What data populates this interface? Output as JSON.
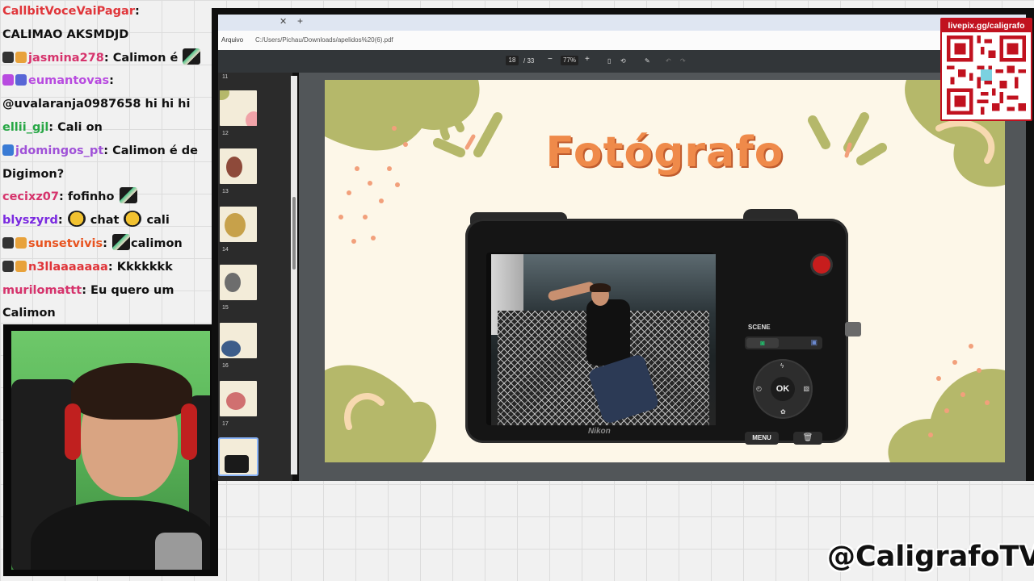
{
  "chat": {
    "lines": [
      {
        "user": "CallbitVoceVaiPagar",
        "color": "#e0353a",
        "message": ""
      },
      {
        "user": "",
        "color": "#111111",
        "message": "CALIMAO AKSMDJD"
      },
      {
        "user": "jasmina278",
        "color": "#d6336c",
        "message": "Calimon é"
      },
      {
        "user": "eumantovas",
        "color": "#b84be0",
        "message": ""
      },
      {
        "user": "",
        "color": "#111111",
        "message": "@uvalaranja0987658 hi hi hi"
      },
      {
        "user": "ellii_gjl",
        "color": "#27a745",
        "message": "Cali on"
      },
      {
        "user": "jdomingos_pt",
        "color": "#a052d8",
        "message": "Calimon é de"
      },
      {
        "user": "",
        "color": "#111111",
        "message": "Digimon?"
      },
      {
        "user": "cecixz07",
        "color": "#d6336c",
        "message": "fofinho"
      },
      {
        "user": "blyszyrd",
        "color": "#7b2be0",
        "message": "chat"
      },
      {
        "user": "sunsetvivis",
        "color": "#e8531f",
        "message": "calimon"
      },
      {
        "user": "n3llaaaaaaa",
        "color": "#e0353a",
        "message": "Kkkkkkk"
      },
      {
        "user": "murilomattt",
        "color": "#d6336c",
        "message": "Eu quero um"
      },
      {
        "user": "",
        "color": "#111111",
        "message": "Calimon"
      }
    ],
    "extra_blyszyrd": "cali"
  },
  "browser": {
    "url_label": "Arquivo",
    "url_path": "C:/Users/Pichau/Downloads/apelidos%20(6).pdf",
    "page_current": "18",
    "page_total": "/ 33",
    "zoom": "77%"
  },
  "sidebar": {
    "page_numbers": [
      "11",
      "12",
      "13",
      "14",
      "15",
      "16",
      "17"
    ]
  },
  "slide": {
    "title": "Fotógrafo",
    "camera_brand": "Nikon",
    "scene_label": "SCENE",
    "ok_label": "OK",
    "menu_label": "MENU"
  },
  "qr": {
    "title": "livepix.gg/caligrafo"
  },
  "watermark": {
    "handle": "@CaligrafoTV"
  },
  "colors": {
    "accent_orange": "#ef8a4a",
    "olive": "#b5b86a",
    "peach": "#f2a07b",
    "qr_red": "#c1121f"
  }
}
